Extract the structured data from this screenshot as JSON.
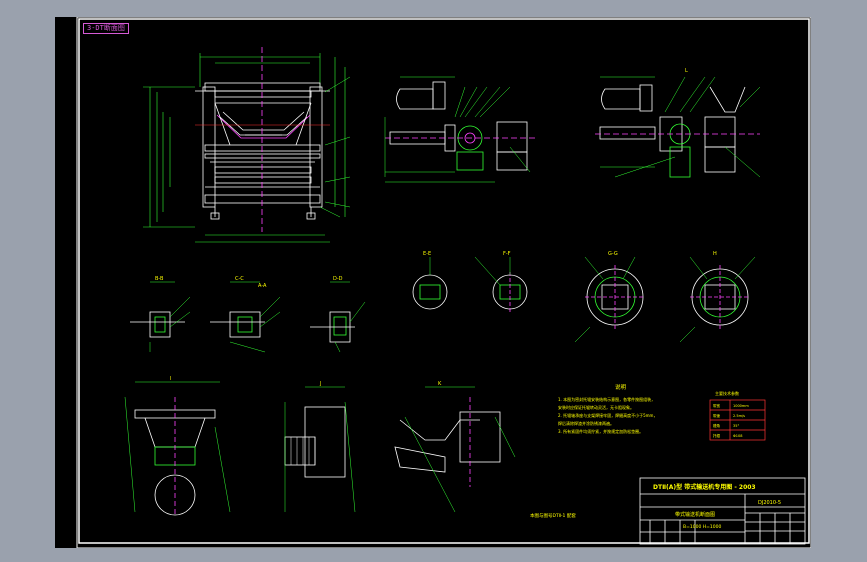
{
  "sheet": {
    "tag": "3-DT断面图"
  },
  "section_labels": [
    "A-A",
    "B-B",
    "C-C",
    "D-D",
    "E-E",
    "F-F",
    "G-G",
    "H",
    "I",
    "J",
    "K",
    "L"
  ],
  "notes": {
    "title": "说明",
    "lines": [
      "1. 本图为密封托辊安装结构示意图，各零件按图组装，",
      "   安装时应保证托辊转动灵活，无卡阻现象。",
      "2. 托辊轴承座与支架焊接牢固，焊缝高度不小于5mm，",
      "   焊后清除焊渣并涂防锈漆两遍。",
      "3. 所有紧固件均须拧紧，并按规定加防松垫圈。"
    ]
  },
  "spec_table": {
    "title": "主要技术参数",
    "rows": [
      [
        "带宽",
        "1000mm"
      ],
      [
        "带速",
        "2.5m/s"
      ],
      [
        "槽角",
        "35°"
      ],
      [
        "托辊",
        "Φ108"
      ]
    ]
  },
  "reference_note": "本图与图号DTⅡ-1 配套",
  "title_block": {
    "org": "DTⅡ(A)型  带式输送机专用图 - 2003",
    "drawing_no": "DJ2010-5",
    "name": "带式输送机断面图",
    "spec": "B=1000 H=1000"
  },
  "colors": {
    "background": "#9aa1ad",
    "paper": "#000000",
    "border": "#ffffff",
    "geometry": "#ffffff",
    "dimension": "#33ff33",
    "centerline": "#ff44ff",
    "text": "#ffff00",
    "accent": "#ff3333"
  }
}
